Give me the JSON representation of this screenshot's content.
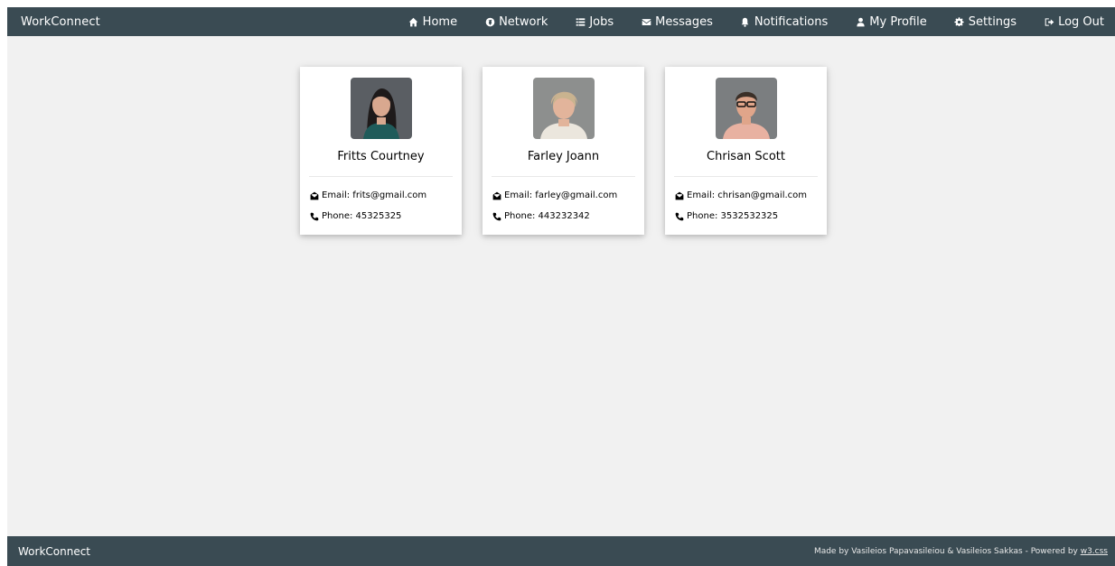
{
  "app": {
    "brand": "WorkConnect"
  },
  "nav": {
    "items": [
      {
        "label": "Home",
        "icon": "home-icon"
      },
      {
        "label": "Network",
        "icon": "globe-icon"
      },
      {
        "label": "Jobs",
        "icon": "list-icon"
      },
      {
        "label": "Messages",
        "icon": "envelope-icon"
      },
      {
        "label": "Notifications",
        "icon": "bell-icon"
      },
      {
        "label": "My Profile",
        "icon": "user-icon"
      },
      {
        "label": "Settings",
        "icon": "gear-icon"
      },
      {
        "label": "Log Out",
        "icon": "sign-out-icon"
      }
    ]
  },
  "contacts": [
    {
      "name": "Fritts Courtney",
      "email": "Email: frits@gmail.com",
      "phone": "Phone: 45325325"
    },
    {
      "name": "Farley Joann",
      "email": "Email: farley@gmail.com",
      "phone": "Phone: 443232342"
    },
    {
      "name": "Chrisan Scott",
      "email": "Email: chrisan@gmail.com",
      "phone": "Phone: 3532532325"
    }
  ],
  "footer": {
    "brand": "WorkConnect",
    "credit_prefix": "Made by Vasileios Papavasileiou & Vasileios Sakkas - Powered by ",
    "credit_link": "w3.css"
  },
  "colors": {
    "bar": "#3a4b53",
    "page_bg": "#f1f1f1"
  }
}
